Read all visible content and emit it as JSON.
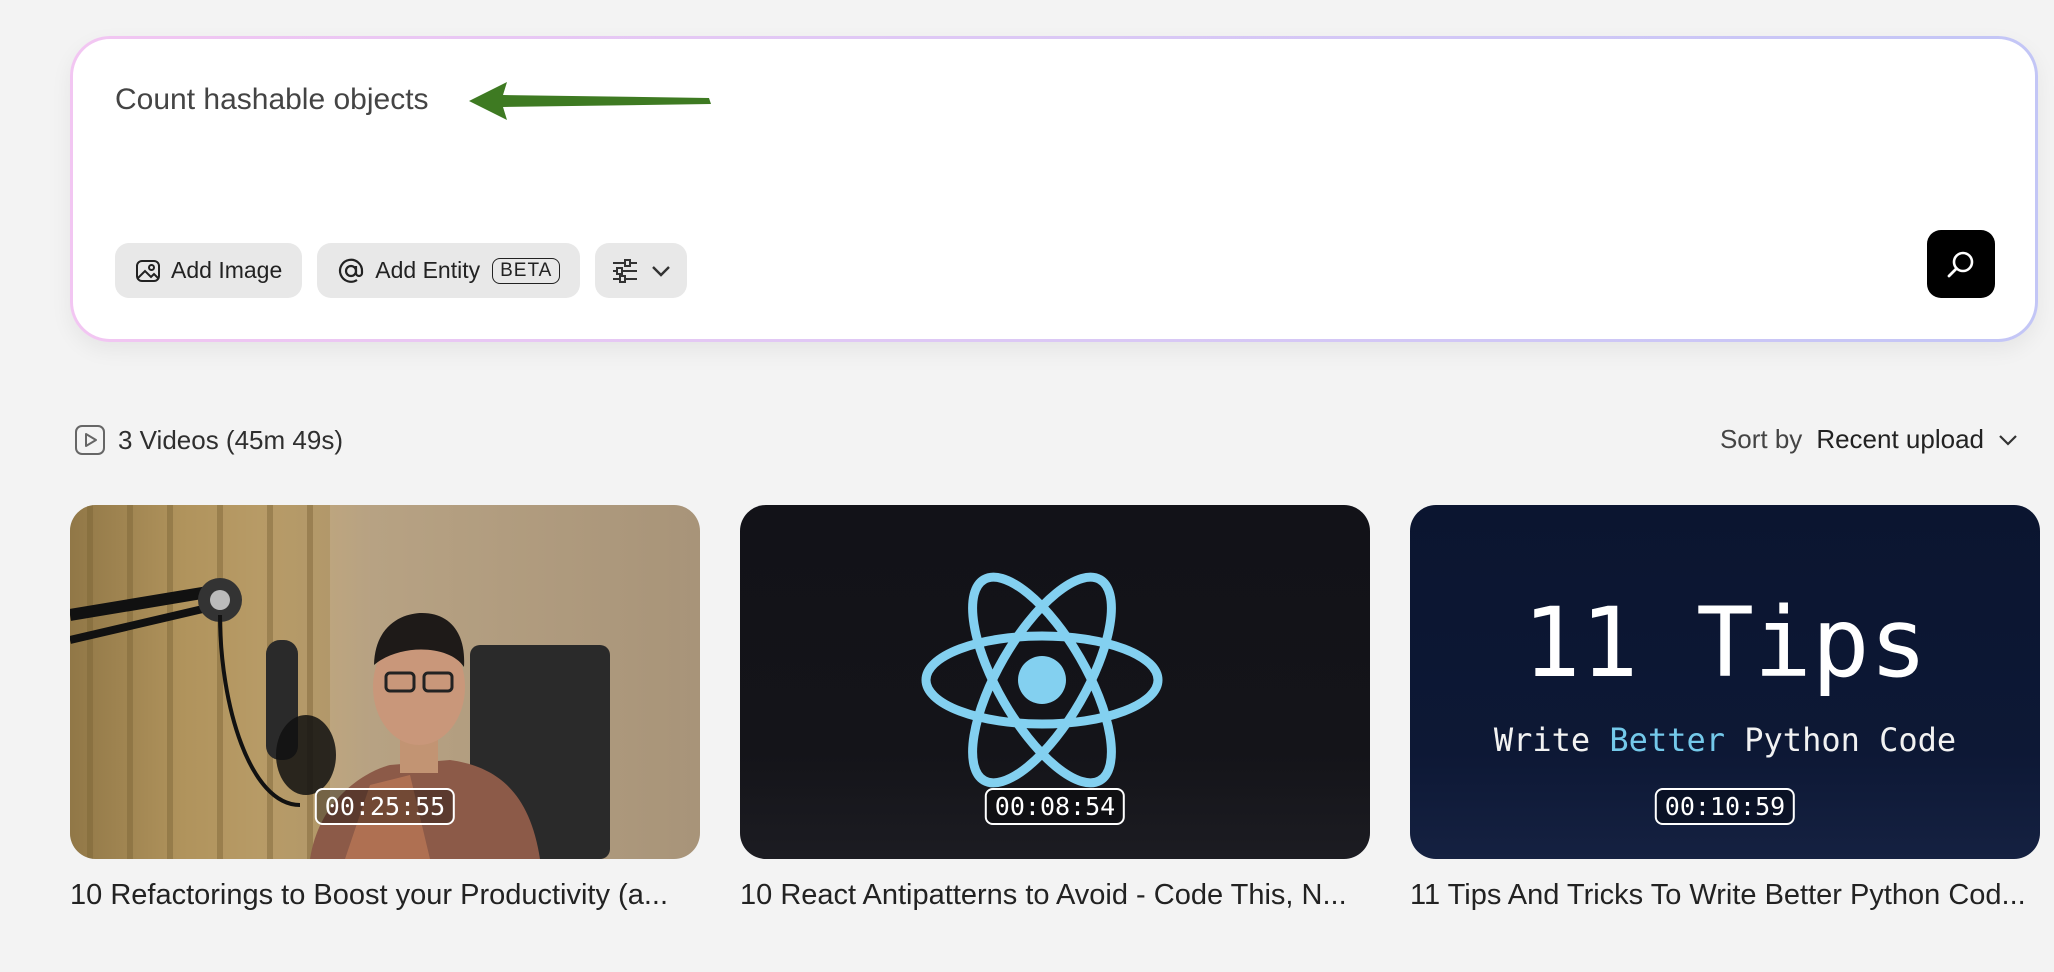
{
  "search": {
    "query": "Count hashable objects",
    "add_image_label": "Add Image",
    "add_entity_label": "Add Entity",
    "beta_badge": "BETA"
  },
  "results": {
    "count_label": "3 Videos (45m 49s)",
    "sort_label": "Sort by",
    "sort_value": "Recent upload"
  },
  "videos": [
    {
      "title": "10 Refactorings to Boost your Productivity (a...",
      "duration": "00:25:55"
    },
    {
      "title": "10 React Antipatterns to Avoid - Code This, N...",
      "duration": "00:08:54"
    },
    {
      "title": "11 Tips And Tricks To Write Better Python Cod...",
      "duration": "00:10:59",
      "thumb_title": "11 Tips",
      "thumb_sub_1": "Write",
      "thumb_sub_hl": "Better",
      "thumb_sub_2": "Python Code"
    }
  ],
  "colors": {
    "arrow": "#3e7a22",
    "react_logo": "#83d0f0",
    "highlight": "#74c9ea"
  }
}
